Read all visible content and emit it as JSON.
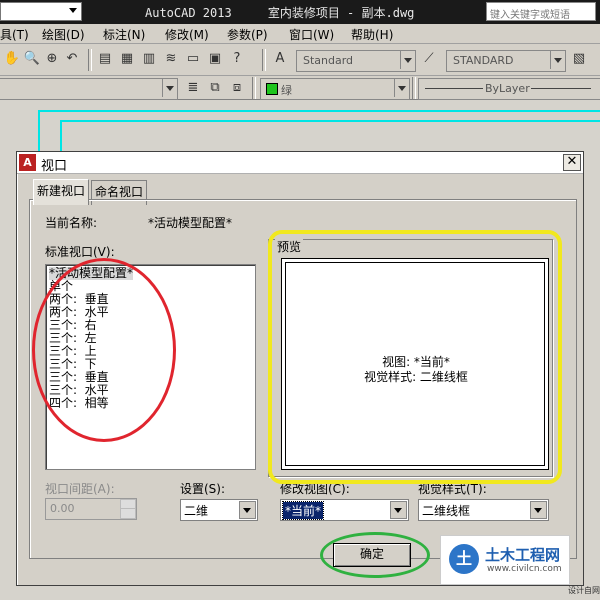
{
  "app": {
    "title": "AutoCAD 2013     室内装修项目 - 副本.dwg",
    "search_placeholder": "键入关键字或短语"
  },
  "menu": [
    {
      "label": "具(T)"
    },
    {
      "label": "绘图(D)"
    },
    {
      "label": "标注(N)"
    },
    {
      "label": "修改(M)"
    },
    {
      "label": "参数(P)"
    },
    {
      "label": "窗口(W)"
    },
    {
      "label": "帮助(H)"
    }
  ],
  "toolbar": {
    "text_style": "Standard",
    "dim_style": "STANDARD",
    "layer_color": "绿",
    "linetype": "ByLayer"
  },
  "dialog": {
    "title": "视口",
    "close_glyph": "✕",
    "tabs": [
      "新建视口",
      "命名视口"
    ],
    "current_name_label": "当前名称:",
    "current_name_value": "*活动模型配置*",
    "std_viewports_label": "标准视口(V):",
    "std_viewports": [
      "*活动模型配置*",
      "单个",
      "两个:  垂直",
      "两个:  水平",
      "三个:  右",
      "三个:  左",
      "三个:  上",
      "三个:  下",
      "三个:  垂直",
      "三个:  水平",
      "四个:  相等"
    ],
    "preview_label": "预览",
    "preview_line1": "视图: *当前*",
    "preview_line2": "视觉样式: 二维线框",
    "spacing_label": "视口间距(A):",
    "spacing_value": "0.00",
    "setup_label": "设置(S):",
    "setup_value": "二维",
    "change_view_label": "修改视图(C):",
    "change_view_value": "*当前*",
    "visual_style_label": "视觉样式(T):",
    "visual_style_value": "二维线框",
    "ok_label": "确定"
  },
  "colors": {
    "layer_swatch": "#1ec41e",
    "annotation_red": "#e0252e",
    "annotation_yellow": "#f1e81e",
    "annotation_green": "#2fb140",
    "drawing_cyan": "#00e5e5"
  },
  "watermark": {
    "logo": "土",
    "title": "土木工程网",
    "url": "www.civilcn.com",
    "small": "设计自网"
  }
}
